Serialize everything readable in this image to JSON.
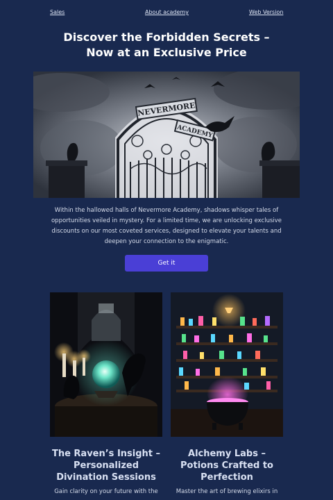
{
  "nav": {
    "sales": "Sales",
    "about": "About academy",
    "web_version": "Web Version"
  },
  "headline": {
    "line1": "Discover the Forbidden Secrets –",
    "line2": "Now at an Exclusive Price"
  },
  "hero": {
    "sign_line1": "NEVERMORE",
    "sign_line2": "ACADEMY"
  },
  "intro": {
    "text": "Within the hallowed halls of Nevermore Academy, shadows whisper tales of opportunities veiled in mystery. For a limited time, we are unlocking exclusive discounts on our most coveted services, designed to elevate your talents and deepen your connection to the enigmatic."
  },
  "cta": {
    "label": "Get it"
  },
  "cards": [
    {
      "title_line1": "The Raven’s Insight –",
      "title_line2": "Personalized",
      "title_line3": "Divination Sessions",
      "desc": "Gain clarity on your future with the"
    },
    {
      "title_line1": "Alchemy Labs –",
      "title_line2": "Potions Crafted to",
      "title_line3": "Perfection",
      "desc": "Master the art of brewing elixirs in"
    }
  ],
  "colors": {
    "background": "#19294f",
    "button": "#4a3fd6",
    "text": "#ffffff",
    "body_text": "#d6dcea"
  }
}
